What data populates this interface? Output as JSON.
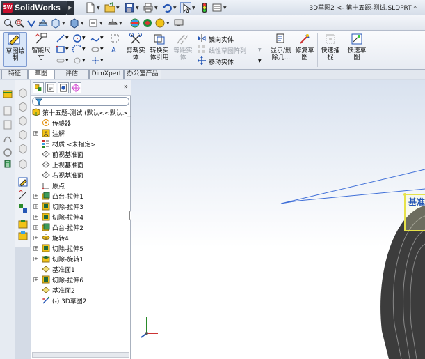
{
  "app": {
    "brand": "SolidWorks",
    "logo_mark": "SW",
    "document_title": "3D草图2 <- 第十五题-测试.SLDPRT *"
  },
  "quick_access": [
    "new-icon",
    "open-icon",
    "save-icon",
    "print-icon",
    "undo-icon",
    "select-arrow-icon",
    "rebuild-icon",
    "options-icon"
  ],
  "view_toolbar": [
    "zoom-fit-icon",
    "zoom-area-icon",
    "previous-view-icon",
    "section-view-icon",
    "view-orientation-icon",
    "display-style-icon",
    "hide-show-icon",
    "edit-appearance-icon",
    "apply-scene-icon",
    "view-settings-icon"
  ],
  "command_manager": {
    "sketch": "草图绘\n制",
    "smart_dimension": "智能尺\n寸",
    "trim": "剪裁实\n体",
    "convert": "转换实\n体引用",
    "offset": "等距实\n体",
    "mirror": "镜向实体",
    "linear_pattern": "线性草图阵列",
    "move": "移动实体",
    "display_delete": "显示/删\n除几...",
    "repair": "修复草\n图",
    "quick_snap": "快速捕\n捉",
    "rapid_sketch": "快速草\n图"
  },
  "tabs": [
    {
      "label": "特征",
      "active": false
    },
    {
      "label": "草图",
      "active": true
    },
    {
      "label": "评估",
      "active": false
    },
    {
      "label": "DimXpert",
      "active": false
    },
    {
      "label": "办公室产品",
      "active": false
    }
  ],
  "feature_tree": {
    "root": "第十五题-测试 (默认<<默认>_",
    "items": [
      {
        "label": "传感器",
        "icon": "sensor-icon",
        "expandable": false
      },
      {
        "label": "注解",
        "icon": "annotations-icon",
        "expandable": true
      },
      {
        "label": "材质 <未指定>",
        "icon": "material-icon",
        "expandable": false
      },
      {
        "label": "前视基准面",
        "icon": "plane-icon",
        "expandable": false
      },
      {
        "label": "上视基准面",
        "icon": "plane-icon",
        "expandable": false
      },
      {
        "label": "右视基准面",
        "icon": "plane-icon",
        "expandable": false
      },
      {
        "label": "原点",
        "icon": "origin-icon",
        "expandable": false
      },
      {
        "label": "凸台-拉伸1",
        "icon": "extrude-boss-icon",
        "expandable": true
      },
      {
        "label": "切除-拉伸3",
        "icon": "extrude-cut-icon",
        "expandable": true
      },
      {
        "label": "切除-拉伸4",
        "icon": "extrude-cut-icon",
        "expandable": true
      },
      {
        "label": "凸台-拉伸2",
        "icon": "extrude-boss-icon",
        "expandable": true
      },
      {
        "label": "旋转4",
        "icon": "revolve-icon",
        "expandable": true
      },
      {
        "label": "切除-拉伸5",
        "icon": "extrude-cut-icon",
        "expandable": true
      },
      {
        "label": "切除-旋转1",
        "icon": "revolve-cut-icon",
        "expandable": true
      },
      {
        "label": "基准面1",
        "icon": "ref-plane-icon",
        "expandable": false
      },
      {
        "label": "切除-拉伸6",
        "icon": "extrude-cut-icon",
        "expandable": true
      },
      {
        "label": "基准面2",
        "icon": "ref-plane-icon",
        "expandable": false
      },
      {
        "label": "(-) 3D草图2",
        "icon": "3d-sketch-icon",
        "expandable": false
      }
    ]
  },
  "graphics": {
    "plane_label": "基准"
  },
  "colors": {
    "accent_blue": "#3f6fd8",
    "sketch_yellow": "#e6e24a",
    "model_dark": "#3c3c3c",
    "brand_red": "#c8102e"
  }
}
